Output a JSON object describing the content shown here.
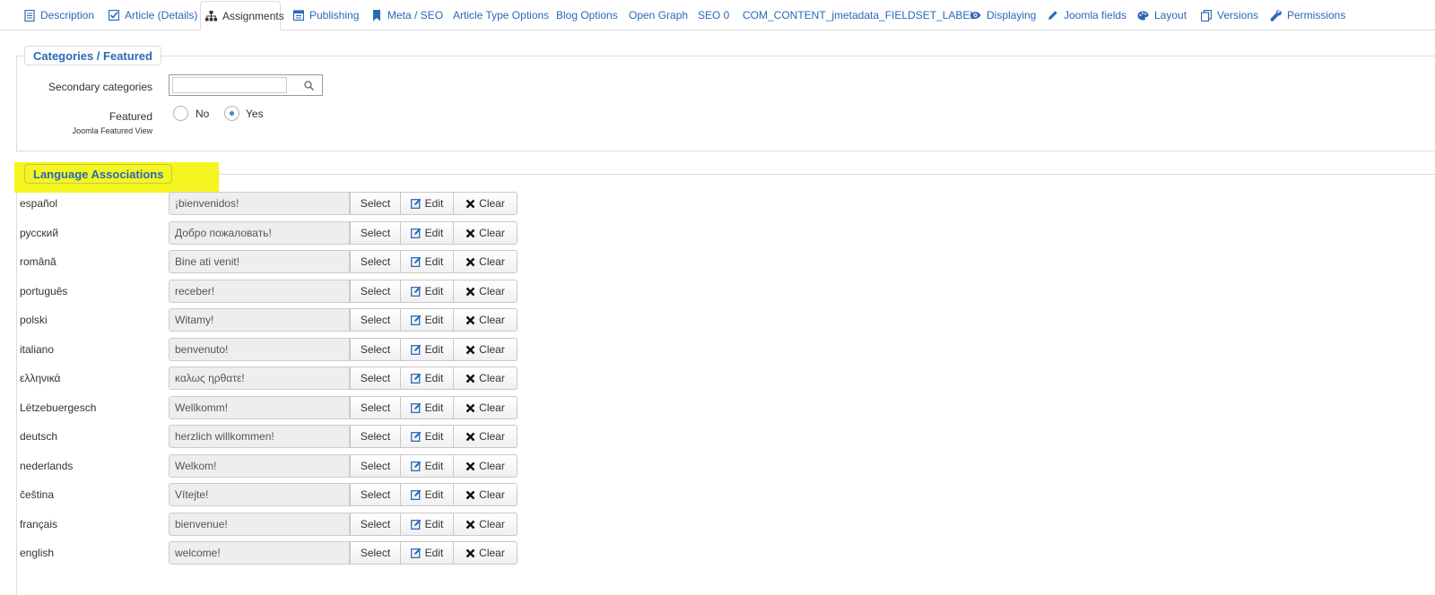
{
  "tabs": [
    {
      "label": "Description",
      "icon": "document-icon"
    },
    {
      "label": "Article (Details)",
      "icon": "checkbox-icon"
    },
    {
      "label": "Assignments",
      "icon": "sitemap-icon",
      "active": true
    },
    {
      "label": "Publishing",
      "icon": "calendar-icon"
    },
    {
      "label": "Meta / SEO",
      "icon": "bookmark-icon"
    },
    {
      "label": "Article Type Options",
      "icon": ""
    },
    {
      "label": "Blog Options",
      "icon": ""
    },
    {
      "label": "Open Graph",
      "icon": ""
    },
    {
      "label": "SEO 0",
      "icon": ""
    },
    {
      "label": "COM_CONTENT_jmetadata_FIELDSET_LABEL",
      "icon": ""
    },
    {
      "label": "Displaying",
      "icon": "eye-icon"
    },
    {
      "label": "Joomla fields",
      "icon": "pencil-icon"
    },
    {
      "label": "Layout",
      "icon": "palette-icon"
    },
    {
      "label": "Versions",
      "icon": "copy-icon"
    },
    {
      "label": "Permissions",
      "icon": "wrench-icon"
    }
  ],
  "categories": {
    "legend": "Categories / Featured",
    "secondary_label": "Secondary categories",
    "search_value": "",
    "featured_label": "Featured",
    "featured_sublabel": "Joomla Featured View",
    "featured_options": [
      {
        "label": "No",
        "checked": false
      },
      {
        "label": "Yes",
        "checked": true
      }
    ]
  },
  "associations": {
    "legend": "Language Associations",
    "highlight_color": "#f5f520",
    "select_label": "Select",
    "edit_label": "Edit",
    "clear_label": "Clear",
    "rows": [
      {
        "language": "español",
        "value": "¡bienvenidos!"
      },
      {
        "language": "русский",
        "value": "Добро пожаловать!"
      },
      {
        "language": "română",
        "value": "Bine ati venit!"
      },
      {
        "language": "português",
        "value": "receber!"
      },
      {
        "language": "polski",
        "value": "Witamy!"
      },
      {
        "language": "italiano",
        "value": "benvenuto!"
      },
      {
        "language": "ελληνικά",
        "value": "καλως ηρθατε!"
      },
      {
        "language": "Lëtzebuergesch",
        "value": "Wellkomm!"
      },
      {
        "language": "deutsch",
        "value": "herzlich willkommen!"
      },
      {
        "language": "nederlands",
        "value": "Welkom!"
      },
      {
        "language": "čeština",
        "value": "Vítejte!"
      },
      {
        "language": "français",
        "value": "bienvenue!"
      },
      {
        "language": "english",
        "value": "welcome!"
      }
    ]
  },
  "colors": {
    "link": "#2a69b8",
    "accent_radio": "#2a8fd8"
  }
}
